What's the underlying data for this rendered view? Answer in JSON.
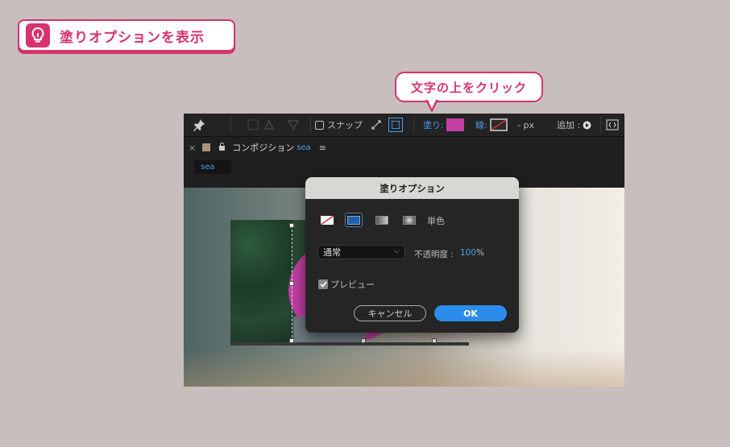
{
  "badge": {
    "text": "塗りオプションを表示",
    "icon": "lightbulb-icon"
  },
  "callout": {
    "text": "文字の上をクリック"
  },
  "toolbar": {
    "snap_label": "スナップ",
    "fill_label": "塗り",
    "colon": ":",
    "stroke_label": "線",
    "stroke_width": "- px",
    "add_label": "追加 :",
    "fill_color": "#c240a4"
  },
  "panel": {
    "close": "×",
    "title": "コンポジション",
    "comp_name": "sea",
    "tab": "sea"
  },
  "dialog": {
    "title": "塗りオプション",
    "mode_label": "単色",
    "blend_value": "通常",
    "opacity_label": "不透明度 :",
    "opacity_value": "100",
    "opacity_unit": "%",
    "preview_label": "プレビュー",
    "cancel_label": "キャンセル",
    "ok_label": "OK"
  },
  "colors": {
    "accent": "#d6336e",
    "ok_button": "#2d8ceb",
    "link_blue": "#4a9fe8"
  }
}
